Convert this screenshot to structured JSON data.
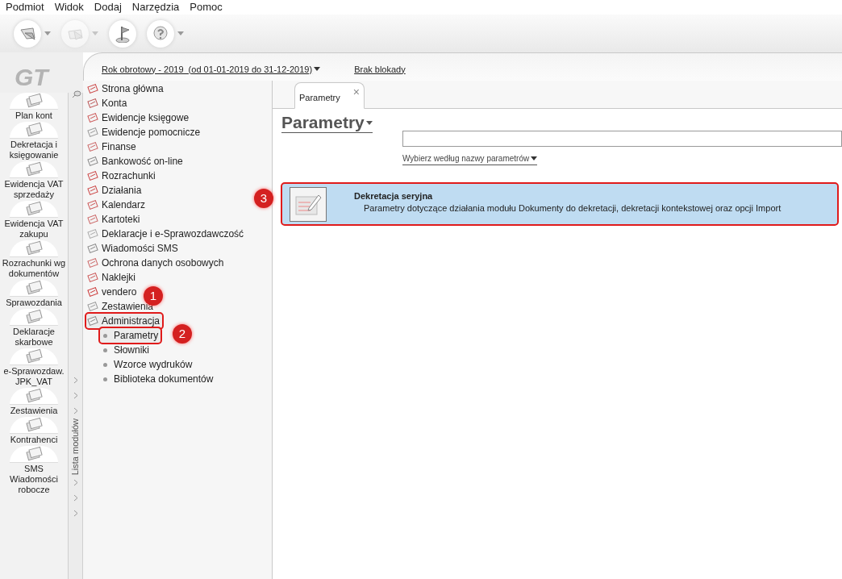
{
  "menu": [
    "Podmiot",
    "Widok",
    "Dodaj",
    "Narzędzia",
    "Pomoc"
  ],
  "toolbar": [
    {
      "kind": "back",
      "has_dropdown": true,
      "disabled": false
    },
    {
      "kind": "forward",
      "has_dropdown": true,
      "disabled": true
    },
    {
      "kind": "flag",
      "has_dropdown": false,
      "disabled": false
    },
    {
      "kind": "help",
      "has_dropdown": true,
      "disabled": false
    }
  ],
  "logo": "GT",
  "modules": [
    "Plan kont",
    "Dekretacja i księgowanie",
    "Ewidencja VAT sprzedaży",
    "Ewidencja VAT zakupu",
    "Rozrachunki wg dokumentów",
    "Sprawozdania",
    "Deklaracje skarbowe",
    "e-Sprawozdaw. JPK_VAT",
    "Zestawienia",
    "Kontrahenci",
    "SMS Wiadomości robocze"
  ],
  "header": {
    "year_selector": "Rok obrotowy - 2019  (od 01-01-2019 do 31-12-2019)",
    "lock_status": "Brak blokady"
  },
  "side_strip": {
    "label": "Lista modułów"
  },
  "tree": [
    {
      "label": "Strona główna",
      "outlined": false
    },
    {
      "label": "Konta",
      "outlined": false
    },
    {
      "label": "Ewidencje księgowe",
      "outlined": false
    },
    {
      "label": "Ewidencje pomocnicze",
      "outlined": false
    },
    {
      "label": "Finanse",
      "outlined": false
    },
    {
      "label": "Bankowość on-line",
      "outlined": false
    },
    {
      "label": "Rozrachunki",
      "outlined": false
    },
    {
      "label": "Działania",
      "outlined": false
    },
    {
      "label": "Kalendarz",
      "outlined": false
    },
    {
      "label": "Kartoteki",
      "outlined": false
    },
    {
      "label": "Deklaracje i e-Sprawozdawczość",
      "outlined": false
    },
    {
      "label": "Wiadomości SMS",
      "outlined": false
    },
    {
      "label": "Ochrona danych osobowych",
      "outlined": false
    },
    {
      "label": "Naklejki",
      "outlined": false
    },
    {
      "label": "vendero",
      "outlined": false
    },
    {
      "label": "Zestawienia",
      "outlined": false
    },
    {
      "label": "Administracja",
      "outlined": true,
      "expanded": true,
      "children": [
        {
          "label": "Parametry",
          "outlined": true
        },
        {
          "label": "Słowniki",
          "outlined": false
        },
        {
          "label": "Wzorce wydruków",
          "outlined": false
        },
        {
          "label": "Biblioteka dokumentów",
          "outlined": false
        }
      ]
    }
  ],
  "tabs": [
    {
      "label": "Parametry",
      "selected": true,
      "close": "×"
    }
  ],
  "page": {
    "title": "Parametry",
    "filter_link": "Wybierz według nazwy parametrów"
  },
  "parameters": [
    {
      "title": "Dekretacja seryjna",
      "description": "Parametry dotyczące działania modułu Dokumenty do dekretacji, dekretacji kontekstowej oraz opcji Import",
      "outlined": true
    }
  ],
  "callouts": [
    "1",
    "2",
    "3"
  ]
}
